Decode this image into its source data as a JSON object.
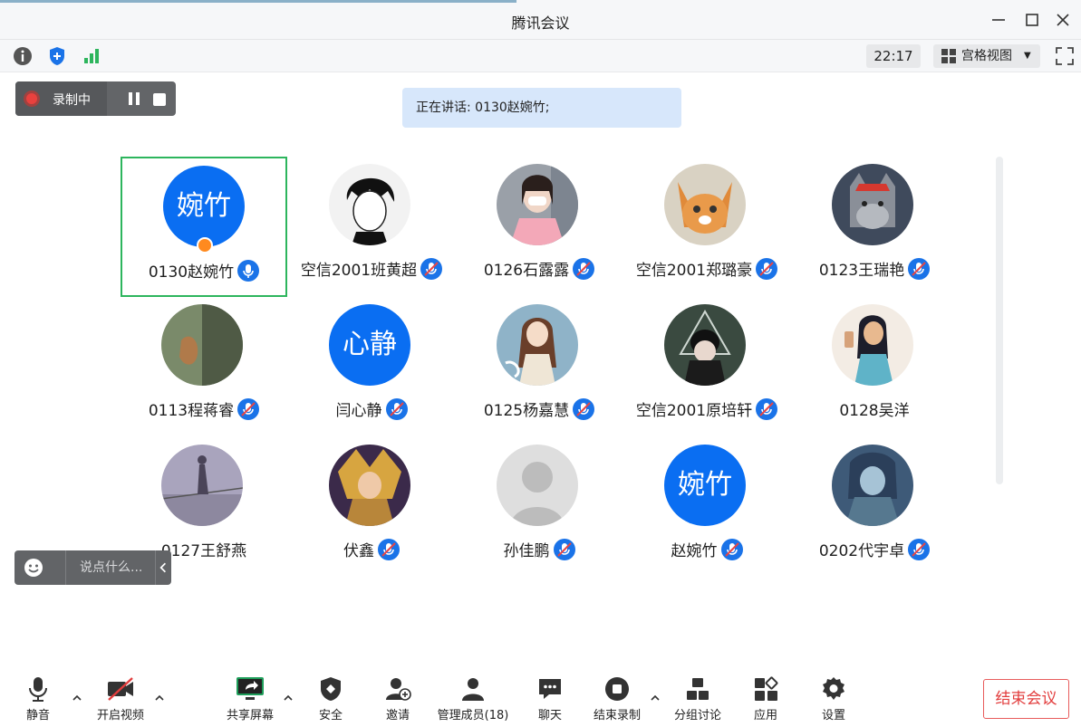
{
  "window": {
    "title": "腾讯会议"
  },
  "top_toolbar": {
    "time": "22:17",
    "view_mode": "宫格视图"
  },
  "recording": {
    "label": "录制中"
  },
  "speaking": {
    "text": "正在讲话: 0130赵婉竹;"
  },
  "participants": [
    {
      "name": "0130赵婉竹",
      "avatar_text": "婉竹",
      "host": true,
      "mic": "active"
    },
    {
      "name": "空信2001班黄超",
      "mic": "muted"
    },
    {
      "name": "0126石露露",
      "mic": "muted"
    },
    {
      "name": "空信2001郑璐豪",
      "mic": "muted"
    },
    {
      "name": "0123王瑞艳",
      "mic": "muted"
    },
    {
      "name": "0113程蒋睿",
      "mic": "muted"
    },
    {
      "name": "闫心静",
      "avatar_text": "心静",
      "mic": "muted"
    },
    {
      "name": "0125杨嘉慧",
      "mic": "muted"
    },
    {
      "name": "空信2001原培轩",
      "mic": "muted"
    },
    {
      "name": "0128吴洋",
      "mic": "none"
    },
    {
      "name": "0127王舒燕",
      "mic": "none"
    },
    {
      "name": "伏鑫",
      "mic": "muted"
    },
    {
      "name": "孙佳鹏",
      "mic": "muted"
    },
    {
      "name": "赵婉竹",
      "avatar_text": "婉竹",
      "mic": "muted"
    },
    {
      "name": "0202代宇卓",
      "mic": "muted"
    }
  ],
  "chat": {
    "placeholder": "说点什么..."
  },
  "bottom_toolbar": {
    "mute": "静音",
    "video": "开启视频",
    "share": "共享屏幕",
    "security": "安全",
    "invite": "邀请",
    "members": "管理成员(18)",
    "chat": "聊天",
    "end_record": "结束录制",
    "breakout": "分组讨论",
    "apps": "应用",
    "settings": "设置",
    "end_meeting": "结束会议"
  },
  "colors": {
    "accent": "#0a6ef2",
    "active_border": "#2db55d",
    "end_red": "#e23d3d",
    "host_badge": "#ff8a1f"
  }
}
